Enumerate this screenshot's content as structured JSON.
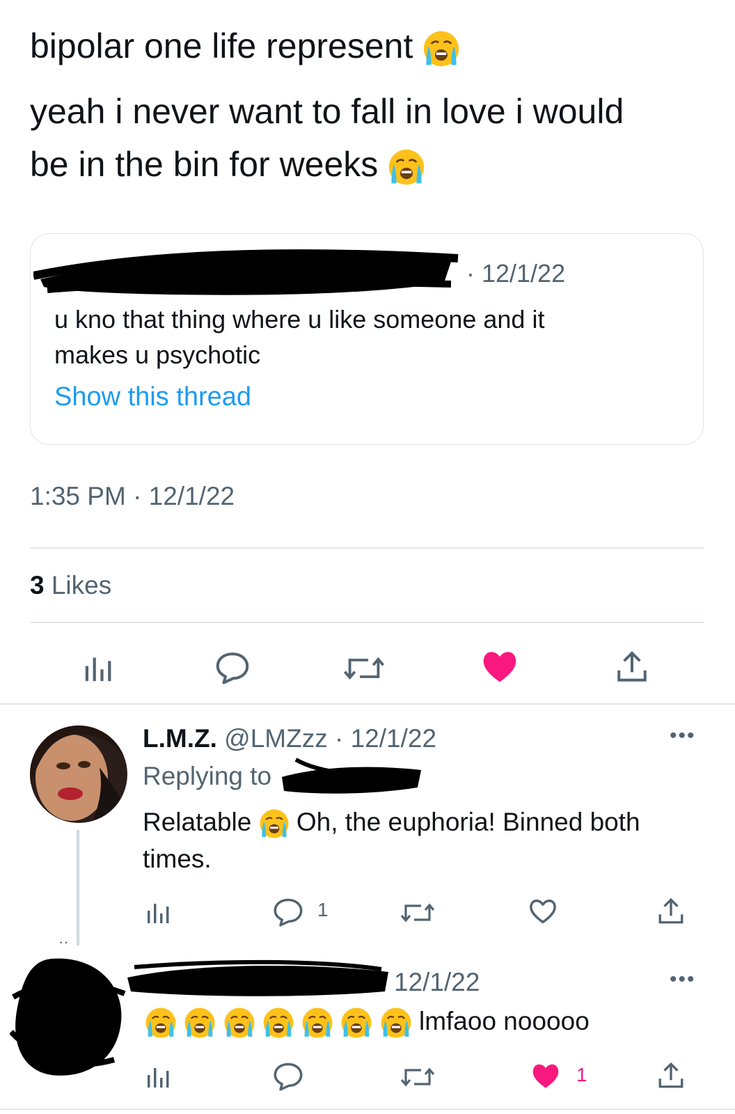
{
  "main_tweet": {
    "line1": "bipolar one life represent",
    "line2": "yeah i never want to fall in love i would",
    "line3": "be in the bin for weeks",
    "quoted": {
      "date": "· 12/1/22",
      "text_line1": "u kno that thing where u like someone and it",
      "text_line2": "makes u psychotic",
      "show_thread": "Show this thread"
    },
    "timestamp": "1:35 PM · 12/1/22",
    "likes_count": "3",
    "likes_label": "Likes"
  },
  "reply1": {
    "name": "L.M.Z.",
    "handle_date": "@LMZzz · 12/1/22",
    "replying_to": "Replying to",
    "text_a": "Relatable",
    "text_b": "Oh, the euphoria! Binned both",
    "text_c": "times.",
    "reply_count": "1"
  },
  "reply2": {
    "date": "12/1/22",
    "text": "lmfaoo nooooo",
    "like_count": "1"
  },
  "colors": {
    "text": "#0f1419",
    "muted": "#536471",
    "link": "#1d9bf0",
    "like": "#f91880",
    "emoji_face": "#fcc21b"
  }
}
